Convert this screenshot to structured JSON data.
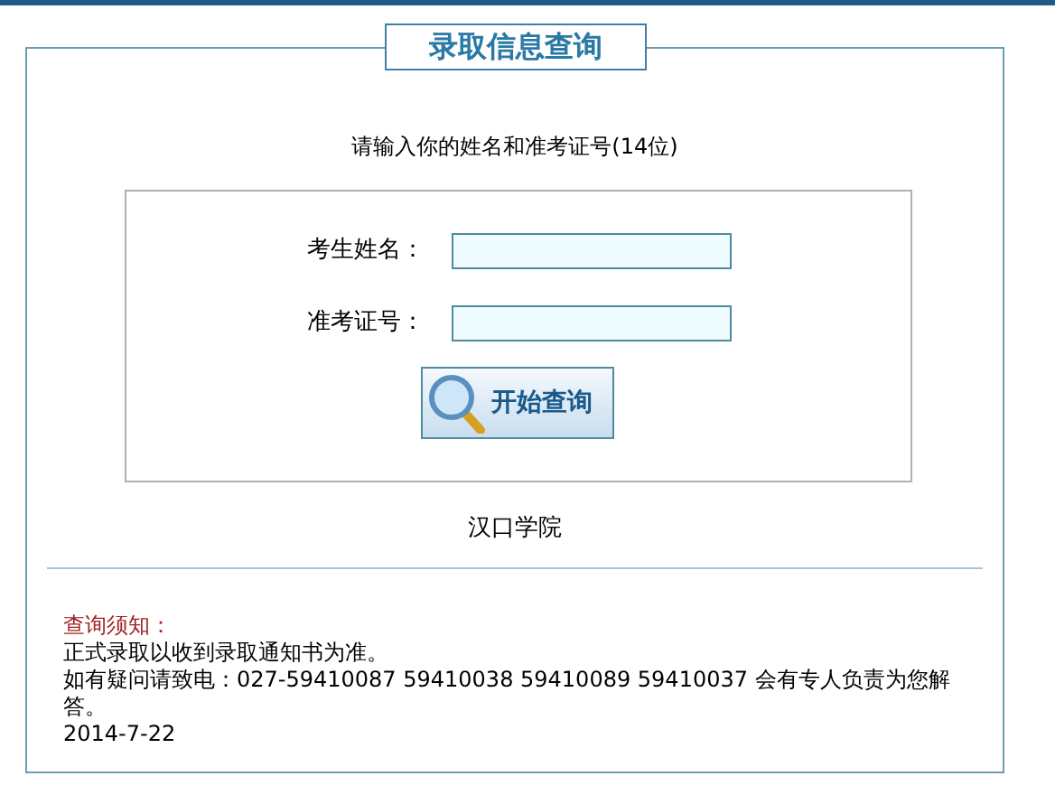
{
  "title": "录取信息查询",
  "instruction": "请输入你的姓名和准考证号(14位)",
  "fields": [
    {
      "label": "考生姓名："
    },
    {
      "label": "准考证号："
    }
  ],
  "search_button": {
    "label": "开始查询"
  },
  "school": "汉口学院",
  "notice": {
    "heading": "查询须知：",
    "lines": [
      "正式录取以收到录取通知书为准。",
      "如有疑问请致电：027-59410087 59410038 59410089 59410037 会有专人负责为您解答。"
    ],
    "date": "2014-7-22"
  }
}
